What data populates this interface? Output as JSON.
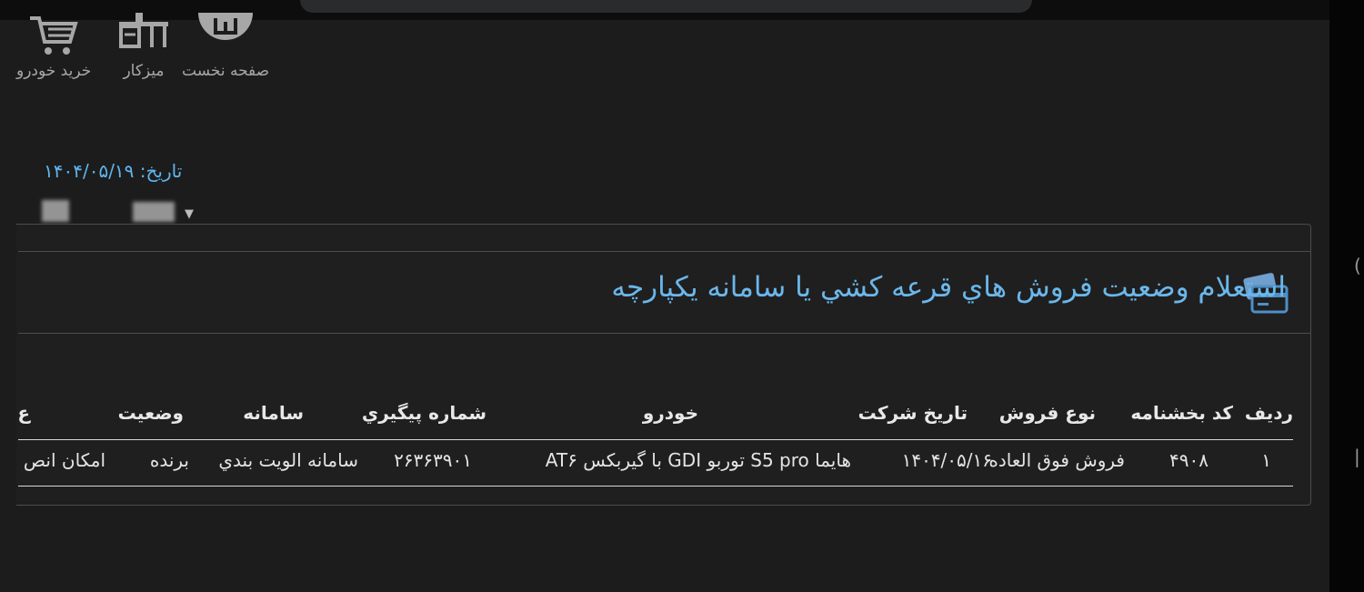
{
  "nav": {
    "items": [
      {
        "label": "صفحه نخست",
        "icon": "home-icon"
      },
      {
        "label": "ميزكار",
        "icon": "desk-icon"
      },
      {
        "label": "خريد خودرو",
        "icon": "cart-icon"
      }
    ]
  },
  "date": {
    "text": "تاریخ: ۱۴۰۴/۰۵/۱۹"
  },
  "panel": {
    "title": "استعلام وضعيت فروش هاي قرعه كشي يا سامانه يكپارچه",
    "icon": "card-icon"
  },
  "table": {
    "headers": {
      "row": "رديف",
      "circular_code": "کد بخشنامه",
      "sale_type": "نوع فروش",
      "reg_date": "تاريخ شركت",
      "car": "خودرو",
      "tracking": "شماره پيگيري",
      "system": "سامانه",
      "status": "وضعيت",
      "extra": "ع"
    },
    "rows": [
      {
        "row": "۱",
        "circular_code": "۴۹۰۸",
        "sale_type": "فروش فوق العاده",
        "reg_date": "۱۴۰۴/۰۵/۱۶",
        "car": "هايما S5 pro توربو GDI با گيربكس AT۶",
        "tracking": "۲۶۳۶۳۹۰۱",
        "system": "سامانه الويت بندي",
        "status": "برنده",
        "extra": "امكان انص"
      }
    ]
  },
  "colors": {
    "accent": "#6bb7ea",
    "date": "#5eb6ee",
    "background": "#1c1c1d"
  }
}
